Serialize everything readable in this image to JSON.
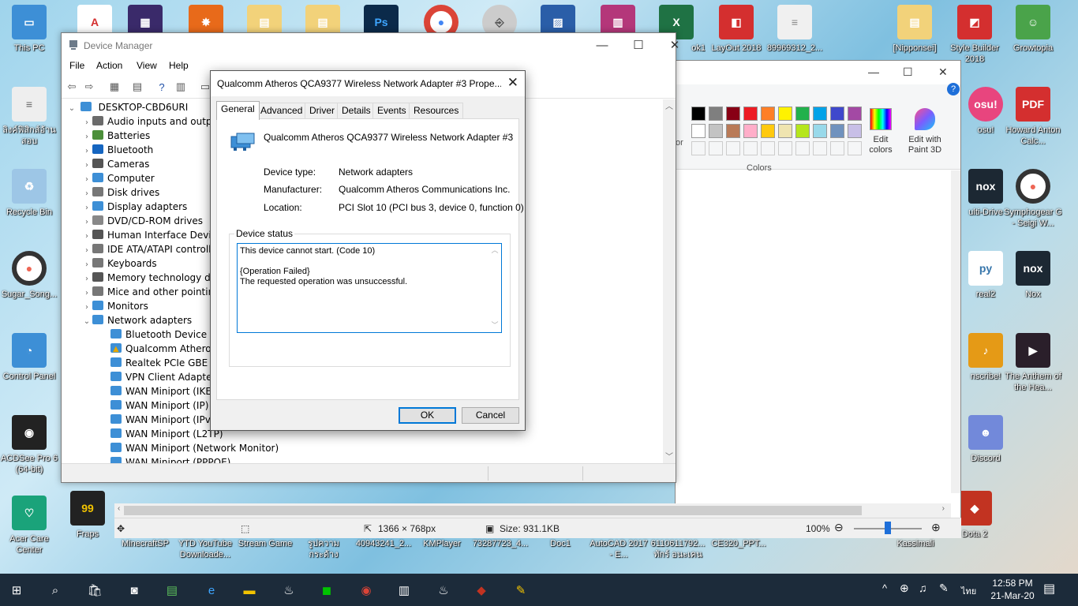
{
  "desktop": {
    "left_icons": [
      {
        "label": "This PC",
        "color": "#3d8fd6"
      },
      {
        "label": "ลิงค์ฟิสิกส์อ้าน สอบ",
        "color": "#e8e8e8"
      },
      {
        "label": "Recycle Bin",
        "color": "#9dc6e6"
      },
      {
        "label": "Sugar_Song...",
        "color": "#333333"
      },
      {
        "label": "Control Panel",
        "color": "#3d8fd6"
      },
      {
        "label": "ACDSee Pro 6 (64-bit)",
        "color": "#222222"
      },
      {
        "label": "Acer Care Center",
        "color": "#1aa37a"
      }
    ],
    "bottom_icons": [
      {
        "label": "Fraps",
        "color": "#f2c300"
      },
      {
        "label": "MinecraftSP",
        "color": ""
      },
      {
        "label": "YTD YouTube Downloade...",
        "color": ""
      },
      {
        "label": "Stream Game",
        "color": ""
      },
      {
        "label": "รูปความกระด้าง",
        "color": ""
      },
      {
        "label": "40943241_2...",
        "color": ""
      },
      {
        "label": "KMPlayer",
        "color": ""
      },
      {
        "label": "73287723_4...",
        "color": ""
      },
      {
        "label": "Doc1",
        "color": ""
      },
      {
        "label": "AutoCAD 2017 - E...",
        "color": ""
      },
      {
        "label": "6110611792... ทักร์ อนะเคน",
        "color": ""
      },
      {
        "label": "CE320_PPT...",
        "color": ""
      },
      {
        "label": "Kassimali",
        "color": ""
      },
      {
        "label": "Dota 2",
        "color": "#c23321"
      }
    ],
    "top_icons": [
      {
        "label": "ok1",
        "color": "#1f7244"
      },
      {
        "label": "LayOut 2018",
        "color": "#d42f2f"
      },
      {
        "label": "89969312_2...",
        "color": "#f0f0f0"
      },
      {
        "label": "[Nipponsei]",
        "color": "#f2d27a"
      },
      {
        "label": "Style Builder 2018",
        "color": "#d42f2f"
      },
      {
        "label": "Growtopia",
        "color": "#4aa34a"
      }
    ],
    "right_icons": [
      {
        "label": "osu!",
        "color": "#e8457e"
      },
      {
        "label": "Howard Anton Calc...",
        "color": "#d42f2f"
      },
      {
        "label": "ulti-Drive",
        "color": "#1c2833"
      },
      {
        "label": "Symphogear G - Seigi W...",
        "color": "#333333"
      },
      {
        "label": "real2",
        "color": "#3776ab"
      },
      {
        "label": "Nox",
        "color": "#1c2833"
      },
      {
        "label": "nscribe!",
        "color": "#e59a16"
      },
      {
        "label": "The Anthem of the Hea...",
        "color": "#2a1f2a"
      },
      {
        "label": "Discord",
        "color": "#7289da"
      }
    ]
  },
  "paint": {
    "colors_label": "Colors",
    "edit_colors": "Edit colors",
    "edit_3d": "Edit with Paint 3D",
    "partial_label": "or",
    "swatches_row1": [
      "#000000",
      "#7f7f7f",
      "#880015",
      "#ed1c24",
      "#ff7f27",
      "#fff200",
      "#22b14c",
      "#00a2e8",
      "#3f48cc",
      "#a349a4"
    ],
    "swatches_row2": [
      "#ffffff",
      "#c3c3c3",
      "#b97a57",
      "#ffaec9",
      "#ffc90e",
      "#efe4b0",
      "#b5e61d",
      "#99d9ea",
      "#7092be",
      "#c8bfe7"
    ],
    "status_dims": "1366 × 768px",
    "status_size": "Size: 931.1KB",
    "zoom": "100%"
  },
  "devmgr": {
    "title": "Device Manager",
    "menu": [
      "File",
      "Action",
      "View",
      "Help"
    ],
    "root": "DESKTOP-CBD6URI",
    "categories": [
      {
        "label": "Audio inputs and outpu",
        "color": "#6b6b6b"
      },
      {
        "label": "Batteries",
        "color": "#4c8f3a"
      },
      {
        "label": "Bluetooth",
        "color": "#1565c0"
      },
      {
        "label": "Cameras",
        "color": "#555555"
      },
      {
        "label": "Computer",
        "color": "#3d8fd6"
      },
      {
        "label": "Disk drives",
        "color": "#777777"
      },
      {
        "label": "Display adapters",
        "color": "#3d8fd6"
      },
      {
        "label": "DVD/CD-ROM drives",
        "color": "#888888"
      },
      {
        "label": "Human Interface Device",
        "color": "#555555"
      },
      {
        "label": "IDE ATA/ATAPI controlle",
        "color": "#777777"
      },
      {
        "label": "Keyboards",
        "color": "#777777"
      },
      {
        "label": "Memory technology dev",
        "color": "#555555"
      },
      {
        "label": "Mice and other pointing",
        "color": "#777777"
      },
      {
        "label": "Monitors",
        "color": "#3d8fd6"
      },
      {
        "label": "Network adapters",
        "color": "#3d8fd6"
      }
    ],
    "network_children": [
      {
        "label": "Bluetooth Device (Pe",
        "warn": false
      },
      {
        "label": "Qualcomm Atheros",
        "warn": true
      },
      {
        "label": "Realtek PCIe GBE Far",
        "warn": false
      },
      {
        "label": "VPN Client Adapter -",
        "warn": false
      },
      {
        "label": "WAN Miniport (IKEv",
        "warn": false
      },
      {
        "label": "WAN Miniport (IP)",
        "warn": false
      },
      {
        "label": "WAN Miniport (IPv6",
        "warn": false
      },
      {
        "label": "WAN Miniport (L2TP)",
        "warn": false
      },
      {
        "label": "WAN Miniport (Network Monitor)",
        "warn": false
      },
      {
        "label": "WAN Miniport (PPPOE)",
        "warn": false
      }
    ]
  },
  "dialog": {
    "title": "Qualcomm Atheros QCA9377 Wireless Network Adapter #3 Prope...",
    "tabs": [
      "General",
      "Advanced",
      "Driver",
      "Details",
      "Events",
      "Resources"
    ],
    "device_name": "Qualcomm Atheros QCA9377 Wireless Network Adapter #3",
    "device_type_label": "Device type:",
    "device_type": "Network adapters",
    "manufacturer_label": "Manufacturer:",
    "manufacturer": "Qualcomm Atheros Communications Inc.",
    "location_label": "Location:",
    "location": "PCI Slot 10 (PCI bus 3, device 0, function 0)",
    "status_group": "Device status",
    "status_line1": "This device cannot start. (Code 10)",
    "status_line2": "{Operation Failed}",
    "status_line3": "The requested operation was unsuccessful.",
    "ok": "OK",
    "cancel": "Cancel"
  },
  "taskbar": {
    "time": "12:58 PM",
    "date": "21-Mar-20",
    "lang": "ไทย"
  }
}
